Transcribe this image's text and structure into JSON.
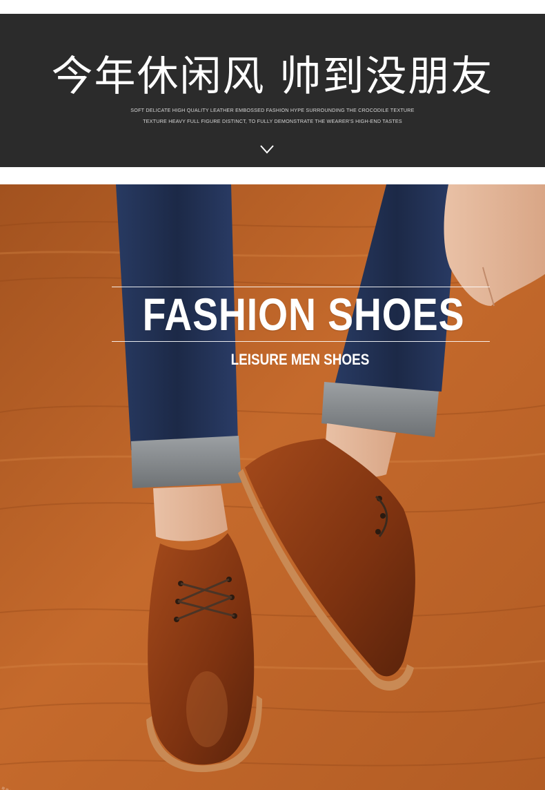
{
  "banner": {
    "title": "今年休闲风 帅到没朋友",
    "line1": "SOFT DELICATE HIGH QUALITY LEATHER  EMBOSSED FASHION HYPE SURROUNDING THE CROCODILE TEXTURE",
    "line2": "TEXTURE HEAVY FULL FIGURE DISTINCT, TO FULLY DEMONSTRATE   THE WEARER'S HIGH-END TASTES",
    "chevron_icon": "chevron-down-icon"
  },
  "hero": {
    "headline": "FASHION SHOES",
    "subhead": "LEISURE MEN SHOES"
  },
  "colors": {
    "banner_bg": "#2b2b2b",
    "floor": "#b55e25",
    "jeans": "#1f2d4f",
    "shoe": "#8a3a12"
  }
}
